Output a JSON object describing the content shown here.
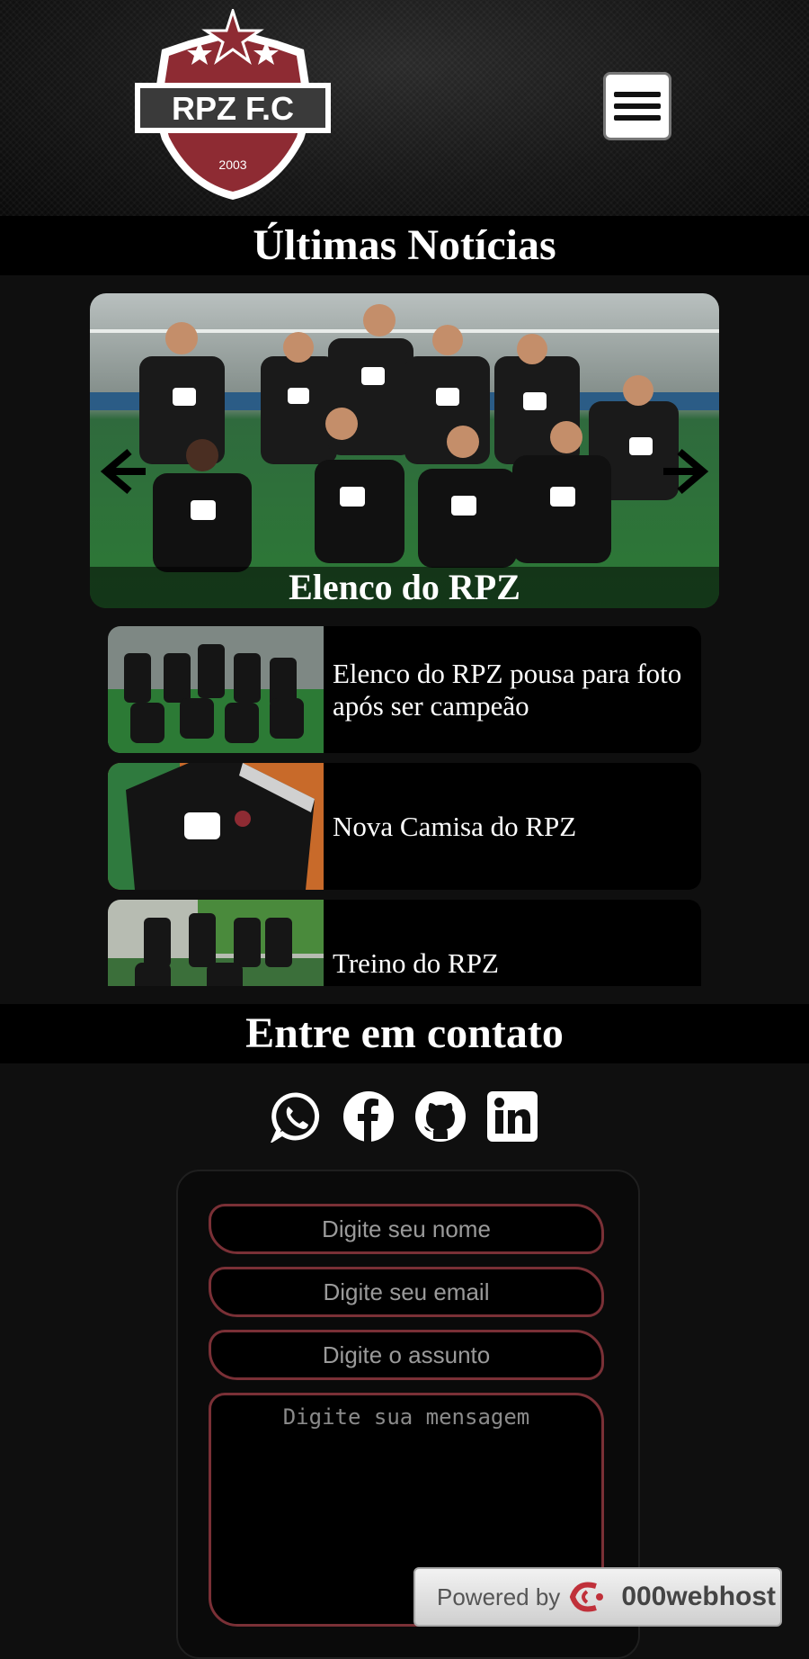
{
  "header": {
    "logo_text": "RPZ F.C",
    "logo_year": "2003",
    "menu_icon": "hamburger-menu-icon"
  },
  "news": {
    "title": "Últimas Notícias",
    "carousel": {
      "caption": "Elenco do RPZ",
      "prev_icon": "arrow-left-icon",
      "next_icon": "arrow-right-icon"
    },
    "items": [
      {
        "label": "Elenco do RPZ pousa para foto após ser campeão",
        "thumb": "team-photo"
      },
      {
        "label": "Nova Camisa do RPZ",
        "thumb": "jersey-photo"
      },
      {
        "label": "Treino do RPZ",
        "thumb": "training-photo"
      }
    ]
  },
  "contact": {
    "title": "Entre em contato",
    "social_icons": [
      "whatsapp-icon",
      "facebook-icon",
      "github-icon",
      "linkedin-icon"
    ],
    "form": {
      "name_placeholder": "Digite seu nome",
      "email_placeholder": "Digite seu email",
      "subject_placeholder": "Digite o assunto",
      "message_placeholder": "Digite sua mensagem"
    }
  },
  "hosting_badge": {
    "powered_by": "Powered by",
    "brand": "000webhost"
  },
  "colors": {
    "accent": "#7a3036",
    "crest_red": "#8e2b33",
    "background": "#0f0f0f"
  }
}
